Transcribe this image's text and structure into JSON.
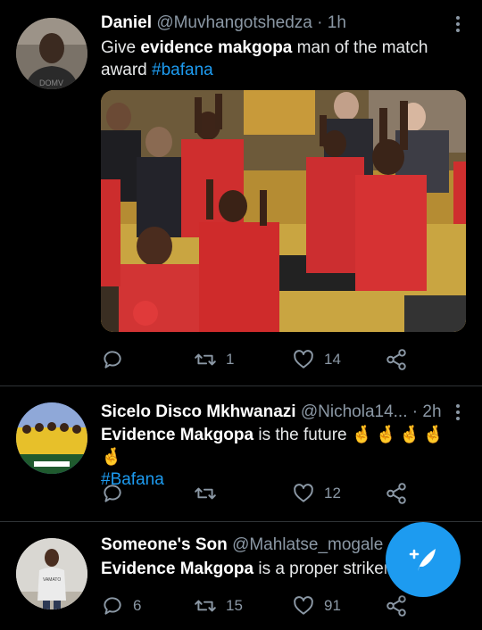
{
  "colors": {
    "background": "#000000",
    "accent": "#1d9bf0",
    "muted": "#8b98a5",
    "photo_seats": "#c9a541",
    "shirts": "#d42b2b"
  },
  "tweets": [
    {
      "name": "Daniel",
      "handle": "@Muvhangotshedza",
      "time": "· 1h",
      "text_pre": "Give ",
      "text_bold": "evidence makgopa",
      "text_post": " man of the match award",
      "hashtag": "#bafana",
      "media_icon": "parliament-photo",
      "reply_count": "",
      "retweet_count": "1",
      "like_count": "14"
    },
    {
      "name": "Sicelo Disco Mkhwanazi",
      "handle": "@Nichola14...",
      "time": "· 2h",
      "text_bold": "Evidence Makgopa",
      "text_post": " is the future",
      "emoji": "🤞🤞🤞🤞🤞",
      "hashtag": "#Bafana",
      "reply_count": "",
      "retweet_count": "",
      "like_count": "12"
    },
    {
      "name": "Someone's Son",
      "handle": "@Mahlatse_mogale",
      "time": "·",
      "text_bold": "Evidence Makgopa",
      "text_post": " is a proper striker.",
      "reply_count": "6",
      "retweet_count": "15",
      "like_count": "91"
    }
  ],
  "icons": {
    "reply": "reply-icon",
    "retweet": "retweet-icon",
    "like": "heart-icon",
    "share": "share-icon",
    "more": "more-icon",
    "compose": "compose-tweet-icon"
  }
}
